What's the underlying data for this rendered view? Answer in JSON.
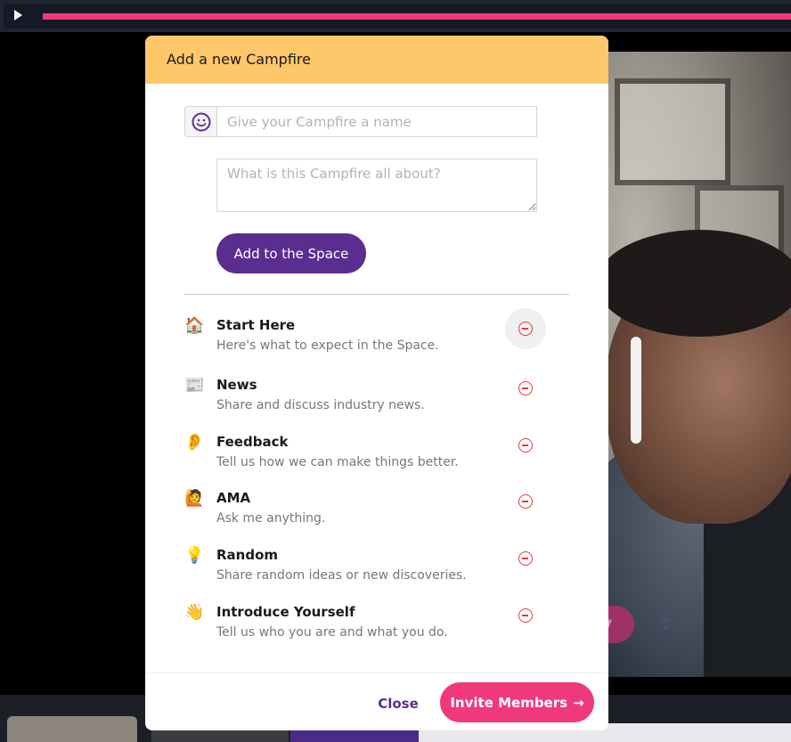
{
  "player": {
    "play_icon": "play-icon",
    "progress_color": "#f0397a"
  },
  "modal": {
    "title": "Add a new Campfire",
    "name_placeholder": "Give your Campfire a name",
    "description_placeholder": "What is this Campfire all about?",
    "add_button": "Add to the Space",
    "emoji_icon": "smiley-icon"
  },
  "channels": [
    {
      "emoji": "🏠",
      "name": "Start Here",
      "description": "Here's what to expect in the Space."
    },
    {
      "emoji": "📰",
      "name": "News",
      "description": "Share and discuss industry news."
    },
    {
      "emoji": "👂",
      "name": "Feedback",
      "description": "Tell us how we can make things better."
    },
    {
      "emoji": "🙋",
      "name": "AMA",
      "description": "Ask me anything."
    },
    {
      "emoji": "💡",
      "name": "Random",
      "description": "Share random ideas or new discoveries."
    },
    {
      "emoji": "👋",
      "name": "Introduce Yourself",
      "description": "Tell us who you are and what you do."
    }
  ],
  "footer": {
    "close": "Close",
    "invite": "Invite Members",
    "invite_arrow": "→"
  },
  "colors": {
    "header": "#fec76a",
    "primary": "#5b2d8e",
    "accent": "#f0397a",
    "remove": "#e23b3b"
  },
  "background": {
    "ghost_button_text": "y"
  }
}
